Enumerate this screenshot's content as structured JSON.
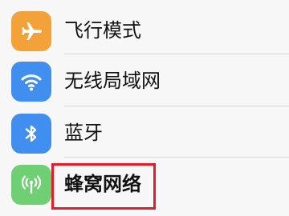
{
  "settings": {
    "items": [
      {
        "label": "飞行模式",
        "icon": "airplane-icon",
        "color": "#f3a23a"
      },
      {
        "label": "无线局域网",
        "icon": "wifi-icon",
        "color": "#3f8ef0"
      },
      {
        "label": "蓝牙",
        "icon": "bluetooth-icon",
        "color": "#3f8ef0"
      },
      {
        "label": "蜂窝网络",
        "icon": "cellular-icon",
        "color": "#6fcf73"
      }
    ],
    "highlight_color": "#e01e2b"
  }
}
